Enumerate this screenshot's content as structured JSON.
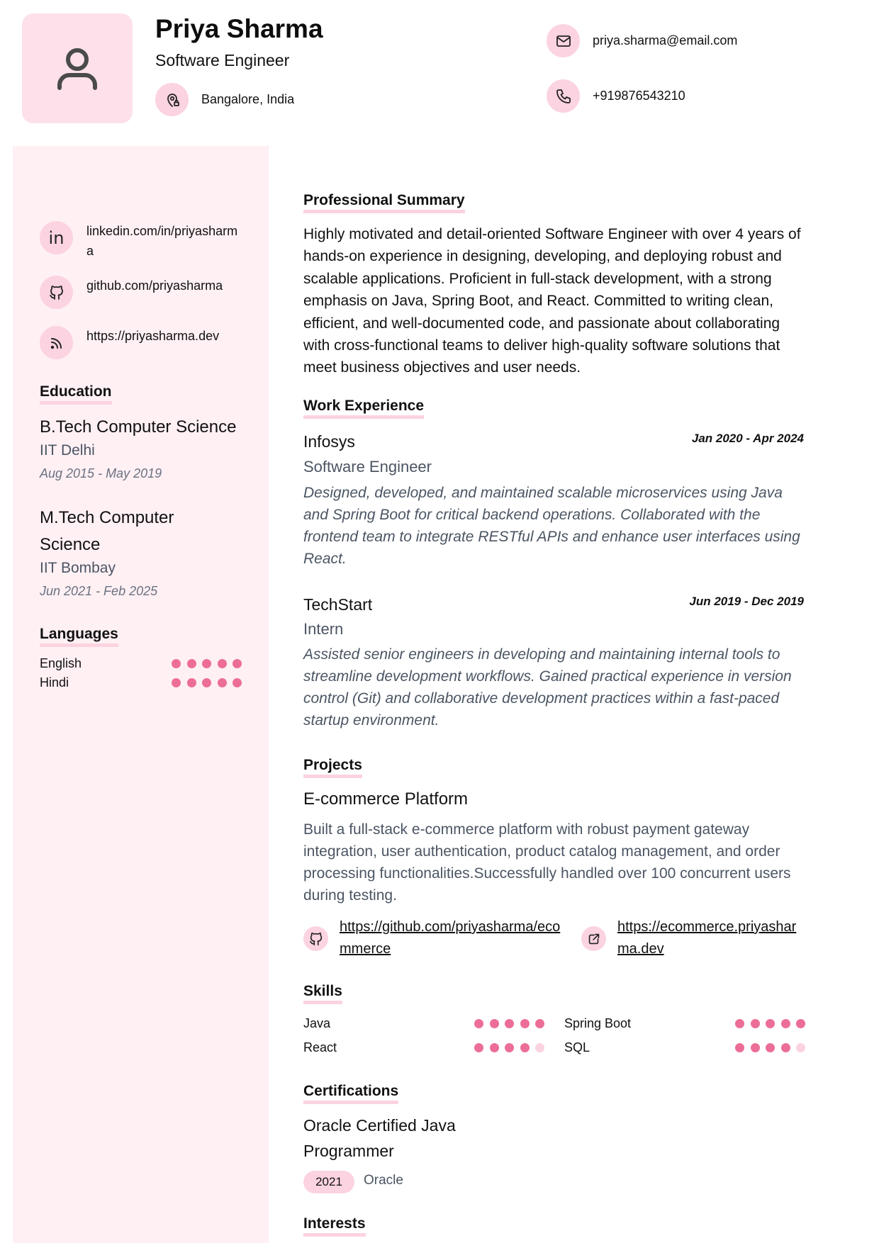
{
  "header": {
    "name": "Priya Sharma",
    "title": "Software Engineer",
    "location": "Bangalore, India",
    "email": "priya.sharma@email.com",
    "phone": "+919876543210"
  },
  "links": {
    "linkedin": "linkedin.com/in/priyasharma",
    "github": "github.com/priyasharma",
    "website": "https://priyasharma.dev"
  },
  "sections": {
    "summary": "Professional Summary",
    "experience": "Work Experience",
    "projects": "Projects",
    "skills": "Skills",
    "certifications": "Certifications",
    "interests": "Interests",
    "education": "Education",
    "languages": "Languages"
  },
  "summary_text": "Highly motivated and detail-oriented Software Engineer with over 4 years of hands-on experience in designing, developing, and deploying robust and scalable applications. Proficient in full-stack development, with a strong emphasis on Java, Spring Boot, and React. Committed to writing clean, efficient, and well-documented code, and passionate about collaborating with cross-functional teams to deliver high-quality software solutions that meet business objectives and user needs.",
  "experience": [
    {
      "company": "Infosys",
      "dates": "Jan 2020 - Apr 2024",
      "role": "Software Engineer",
      "description": "Designed, developed, and maintained scalable microservices using Java and Spring Boot for critical backend operations. Collaborated with the frontend team to integrate RESTful APIs and enhance user interfaces using React."
    },
    {
      "company": "TechStart",
      "dates": "Jun 2019 - Dec 2019",
      "role": "Intern",
      "description": "Assisted senior engineers in developing and maintaining internal tools to streamline development workflows. Gained practical experience in version control (Git) and collaborative development practices within a fast-paced startup environment."
    }
  ],
  "projects": [
    {
      "title": "E-commerce Platform",
      "description": "Built a full-stack e-commerce platform with robust payment gateway integration, user authentication, product catalog management, and order processing functionalities.Successfully handled over 100 concurrent users during testing.",
      "repo": "https://github.com/priyasharma/ecommerce",
      "live": "https://ecommerce.priyasharma.dev"
    }
  ],
  "skills": [
    {
      "name": "Java",
      "level": 5
    },
    {
      "name": "Spring Boot",
      "level": 5
    },
    {
      "name": "React",
      "level": 4
    },
    {
      "name": "SQL",
      "level": 4
    }
  ],
  "certifications": [
    {
      "title": "Oracle Certified Java Programmer",
      "year": "2021",
      "issuer": "Oracle"
    }
  ],
  "education": [
    {
      "degree": "B.Tech Computer Science",
      "school": "IIT Delhi",
      "dates": "Aug 2015 - May 2019"
    },
    {
      "degree": "M.Tech Computer Science",
      "school": "IIT Bombay",
      "dates": "Jun 2021 - Feb 2025"
    }
  ],
  "languages": [
    {
      "name": "English",
      "level": 5
    },
    {
      "name": "Hindi",
      "level": 5
    }
  ],
  "colors": {
    "accent": "#ec6e96",
    "accent_light": "#fcd3e0",
    "sidebar_bg": "#fff0f4"
  }
}
